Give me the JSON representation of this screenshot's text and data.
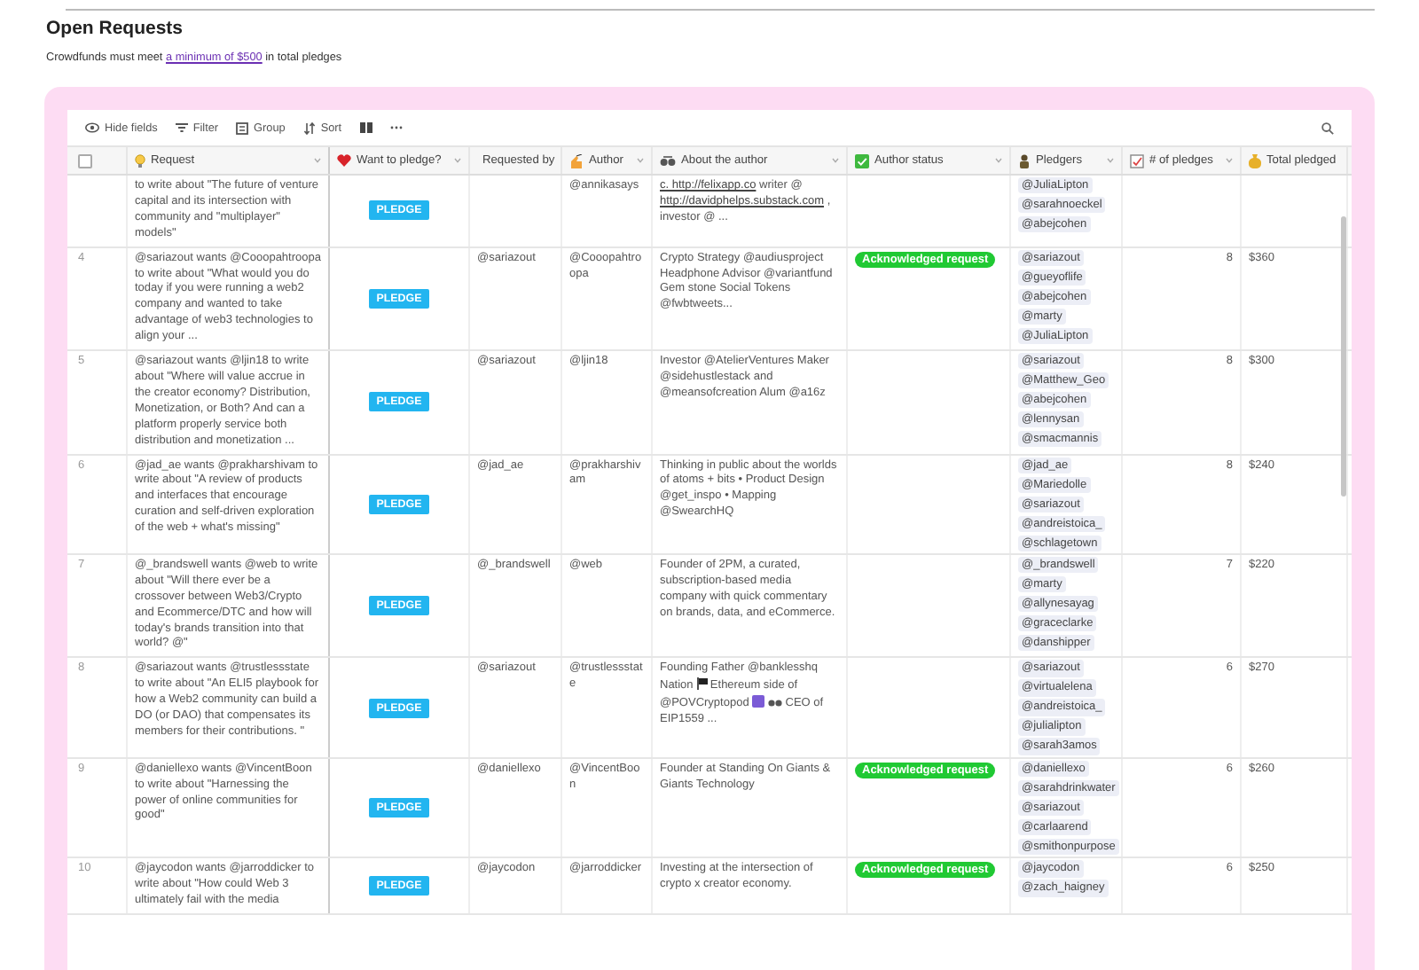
{
  "title": "Open Requests",
  "subtitle": {
    "before": "Crowdfunds must meet",
    "link": "a minimum of $500",
    "after": "in total pledges"
  },
  "toolbar": [
    {
      "kind": "hide",
      "label": "Hide fields"
    },
    {
      "kind": "filter",
      "label": "Filter"
    },
    {
      "kind": "group",
      "label": "Group"
    },
    {
      "kind": "sort",
      "label": "Sort"
    },
    {
      "kind": "rowheight"
    },
    {
      "kind": "more"
    }
  ],
  "select_all": {
    "checked": false
  },
  "columns": [
    {
      "label": "Request"
    },
    {
      "label": "Want to pledge?"
    },
    {
      "label": "Requested by"
    },
    {
      "label": "Author"
    },
    {
      "label": "About the author"
    },
    {
      "label": "Author status"
    },
    {
      "label": "Pledgers"
    },
    {
      "label": "# of pledges"
    },
    {
      "label": "Total pledged"
    }
  ],
  "rows": [
    {
      "request": "to write about \"The future of venture capital and its intersection with community and \"multiplayer\" models\"",
      "pledge_button": "PLEDGE",
      "author": "@annikasays",
      "about": [
        {
          "kind": "link",
          "text": "c. http://felixapp.co"
        },
        {
          "kind": "text",
          "text": "writer @"
        },
        {
          "kind": "link",
          "text": "http://davidphelps.substack.com"
        },
        {
          "kind": "text",
          "text": ", investor @ ..."
        }
      ],
      "pledgers": [
        "@JuliaLipton",
        "@sarahnoeckel",
        "@abejcohen"
      ]
    },
    {
      "number": "4",
      "request": "@sariazout wants @Cooopahtroopa to write about \"What would you do today if you were running a web2 company and wanted to take advantage of web3 technologies to align your ...",
      "pledge_button": "PLEDGE",
      "requested_by": "@sariazout",
      "author": "@Cooopahtroopa",
      "about": [
        {
          "kind": "text",
          "text": "Crypto Strategy @audiusproject Headphone Advisor @variantfund Gem stone Social Tokens @fwbtweets..."
        }
      ],
      "status": "Acknowledged request",
      "pledgers": [
        "@sariazout",
        "@gueyoflife",
        "@abejcohen",
        "@marty",
        "@JuliaLipton"
      ],
      "count": "8",
      "total": "$360"
    },
    {
      "number": "5",
      "request": "@sariazout wants @ljin18 to write about \"Where will value accrue in the creator economy? Distribution, Monetization, or Both? And can a platform properly service both distribution and monetization ...",
      "pledge_button": "PLEDGE",
      "requested_by": "@sariazout",
      "author": "@ljin18",
      "about": [
        {
          "kind": "text",
          "text": "Investor @AtelierVentures Maker @sidehustlestack and @meansofcreation Alum @a16z"
        }
      ],
      "pledgers": [
        "@sariazout",
        "@Matthew_Geo",
        "@abejcohen",
        "@lennysan",
        "@smacmannis"
      ],
      "count": "8",
      "total": "$300"
    },
    {
      "number": "6",
      "request": "@jad_ae wants @prakharshivam to write about \"A review of products and interfaces that encourage curation and self-driven exploration of the web + what's missing\"",
      "pledge_button": "PLEDGE",
      "requested_by": "@jad_ae",
      "author": "@prakharshivam",
      "about": [
        {
          "kind": "text",
          "text": "Thinking in public about the worlds of atoms + bits • Product Design @get_inspo • Mapping @SwearchHQ"
        }
      ],
      "pledgers": [
        "@jad_ae",
        "@Mariedolle",
        "@sariazout",
        "@andreistoica_",
        "@schlagetown"
      ],
      "count": "8",
      "total": "$240"
    },
    {
      "number": "7",
      "request": "@_brandswell wants @web to write about \"Will there ever be a crossover between Web3/Crypto and Ecommerce/DTC and how will today's brands transition into that world? @\"",
      "pledge_button": "PLEDGE",
      "requested_by": "@_brandswell",
      "author": "@web",
      "about": [
        {
          "kind": "text",
          "text": "Founder of 2PM, a curated, subscription-based media company with quick commentary on brands, data, and eCommerce."
        }
      ],
      "pledgers": [
        "@_brandswell",
        "@marty",
        "@allynesayag",
        "@graceclarke",
        "@danshipper"
      ],
      "count": "7",
      "total": "$220"
    },
    {
      "number": "8",
      "request": "@sariazout wants @trustlessstate to write about \"An ELI5 playbook for how a Web2 community can build a DO (or DAO) that compensates its members for their contributions. \"",
      "pledge_button": "PLEDGE",
      "requested_by": "@sariazout",
      "author": "@trustlessstate",
      "about": [
        {
          "kind": "text",
          "text": "Founding Father @banklesshq Nation"
        },
        {
          "kind": "flag"
        },
        {
          "kind": "text",
          "text": "Ethereum side of @POVCryptopod"
        },
        {
          "kind": "square"
        },
        {
          "kind": "glasses"
        },
        {
          "kind": "text",
          "text": "CEO of EIP1559 ..."
        }
      ],
      "pledgers": [
        "@sariazout",
        "@virtualelena",
        "@andreistoica_",
        "@julialipton",
        "@sarah3amos"
      ],
      "count": "6",
      "total": "$270"
    },
    {
      "number": "9",
      "request": "@daniellexo wants @VincentBoon to write about \"Harnessing the power of online communities for good\"",
      "pledge_button": "PLEDGE",
      "requested_by": "@daniellexo",
      "author": "@VincentBoon",
      "about": [
        {
          "kind": "text",
          "text": "Founder at Standing On Giants & Giants Technology"
        }
      ],
      "status": "Acknowledged request",
      "pledgers": [
        "@daniellexo",
        "@sarahdrinkwater",
        "@sariazout",
        "@carlaarend",
        "@smithonpurpose"
      ],
      "count": "6",
      "total": "$260"
    },
    {
      "number": "10",
      "request": "@jaycodon wants @jarroddicker to write about \"How could Web 3 ultimately fail with the media",
      "pledge_button": "PLEDGE",
      "requested_by": "@jaycodon",
      "author": "@jarroddicker",
      "about": [
        {
          "kind": "text",
          "text": "Investing at the intersection of crypto x creator economy."
        }
      ],
      "status": "Acknowledged request",
      "pledgers": [
        "@jaycodon",
        "@zach_haigney"
      ],
      "count": "6",
      "total": "$250"
    }
  ]
}
